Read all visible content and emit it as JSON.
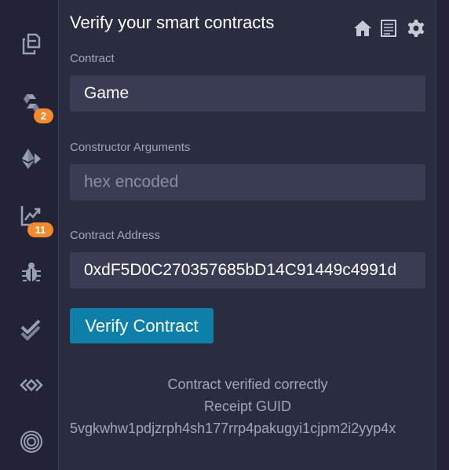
{
  "plugin": {
    "title": "Verify your smart contracts",
    "header_icons": [
      "home-icon",
      "document-icon",
      "gear-icon"
    ]
  },
  "iconbar": {
    "items": [
      {
        "icon": "file-explorer-icon"
      },
      {
        "icon": "solidity-compiler-icon",
        "badge": "2"
      },
      {
        "icon": "deploy-run-icon"
      },
      {
        "icon": "analytics-icon",
        "badge": "11"
      },
      {
        "icon": "debugger-icon"
      },
      {
        "icon": "test-icon"
      },
      {
        "icon": "plugin-icon"
      },
      {
        "icon": "target-icon"
      }
    ]
  },
  "form": {
    "contract_label": "Contract",
    "contract_value": "Game",
    "constructor_label": "Constructor Arguments",
    "constructor_placeholder": "hex encoded",
    "address_label": "Contract Address",
    "address_value": "0xdF5D0C270357685bD14C91449c4991d",
    "verify_button": "Verify Contract"
  },
  "result": {
    "status": "Contract verified correctly",
    "receipt_label": "Receipt GUID",
    "receipt_guid": "5vgkwhw1pdjzrph4sh177rrp4pakugyi1cjpm2i2yyp4x"
  },
  "colors": {
    "accent": "#0d7fa8",
    "badge": "#f48a2c",
    "iconbar_bg": "#222336",
    "panel_bg": "#2a2c3f",
    "field_bg": "#3a3c54"
  }
}
